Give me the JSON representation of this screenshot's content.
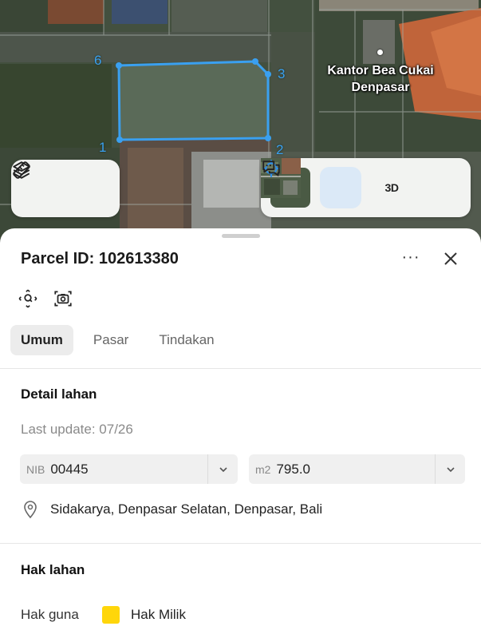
{
  "map": {
    "poi_label": "Kantor Bea Cukai Denpasar",
    "parcel_color": "#3aa0f0",
    "vertices": [
      "1",
      "2",
      "3",
      "6"
    ]
  },
  "map_toolbar": {
    "left": [
      {
        "icon": "layers-icon"
      },
      {
        "icon": "ruler-icon"
      }
    ],
    "right": [
      {
        "icon": "satellite-thumbnail"
      },
      {
        "icon": "crosshair-icon",
        "active": true
      },
      {
        "label": "3D"
      },
      {
        "icon": "chat-icon"
      }
    ]
  },
  "sheet": {
    "title": "Parcel ID: 102613380",
    "more_label": "···",
    "tabs": [
      {
        "label": "Umum",
        "active": true
      },
      {
        "label": "Pasar",
        "active": false
      },
      {
        "label": "Tindakan",
        "active": false
      }
    ],
    "detail": {
      "title": "Detail lahan",
      "last_update": "Last update: 07/26",
      "nib_prefix": "NIB",
      "nib_value": "00445",
      "area_prefix": "m2",
      "area_value": "795.0",
      "address": "Sidakarya, Denpasar Selatan, Denpasar, Bali"
    },
    "rights": {
      "title": "Hak lahan",
      "label": "Hak guna",
      "value": "Hak Milik",
      "swatch_color": "#ffd60a"
    }
  }
}
